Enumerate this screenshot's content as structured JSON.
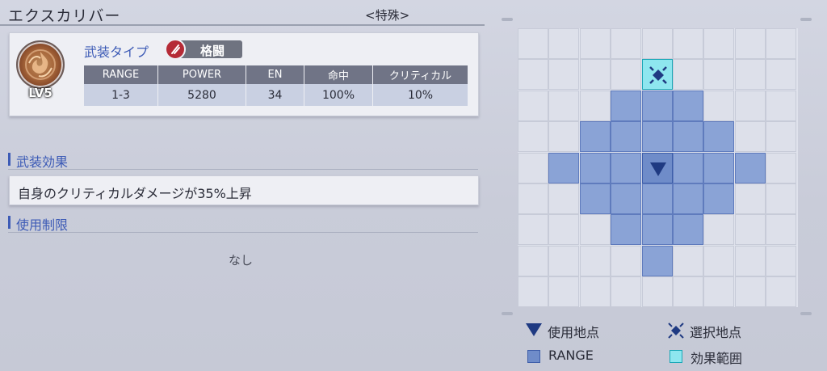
{
  "header": {
    "weapon_name": "エクスカリバー",
    "category": "<特殊>"
  },
  "weapon": {
    "level": "LV5",
    "type_label": "武装タイプ",
    "type_value": "格闘",
    "stats_headers": [
      "RANGE",
      "POWER",
      "EN",
      "命中",
      "クリティカル"
    ],
    "stats_values": [
      "1-3",
      "5280",
      "34",
      "100%",
      "10%"
    ]
  },
  "effect_section": {
    "title": "武装効果",
    "text": "自身のクリティカルダメージが35%上昇"
  },
  "restriction_section": {
    "title": "使用制限",
    "value": "なし"
  },
  "range_grid": {
    "cols": 9,
    "rows": 9,
    "range_cells": [
      [
        3,
        2
      ],
      [
        4,
        2
      ],
      [
        5,
        2
      ],
      [
        2,
        3
      ],
      [
        3,
        3
      ],
      [
        4,
        3
      ],
      [
        5,
        3
      ],
      [
        6,
        3
      ],
      [
        1,
        4
      ],
      [
        2,
        4
      ],
      [
        3,
        4
      ],
      [
        5,
        4
      ],
      [
        6,
        4
      ],
      [
        7,
        4
      ],
      [
        2,
        5
      ],
      [
        3,
        5
      ],
      [
        4,
        5
      ],
      [
        5,
        5
      ],
      [
        6,
        5
      ],
      [
        3,
        6
      ],
      [
        4,
        6
      ],
      [
        5,
        6
      ],
      [
        4,
        7
      ]
    ],
    "origin_cell": [
      4,
      4
    ],
    "effect_cell": [
      4,
      1
    ]
  },
  "legend": {
    "use_point": "使用地点",
    "select_point": "選択地点",
    "range": "RANGE",
    "effect_area": "効果範囲"
  },
  "colors": {
    "accent": "#3d5bb6",
    "range_cell": "#8aa3d6",
    "effect_cell": "#8ee6ef",
    "marker": "#1f3a82",
    "type_icon": "#b52a36"
  }
}
